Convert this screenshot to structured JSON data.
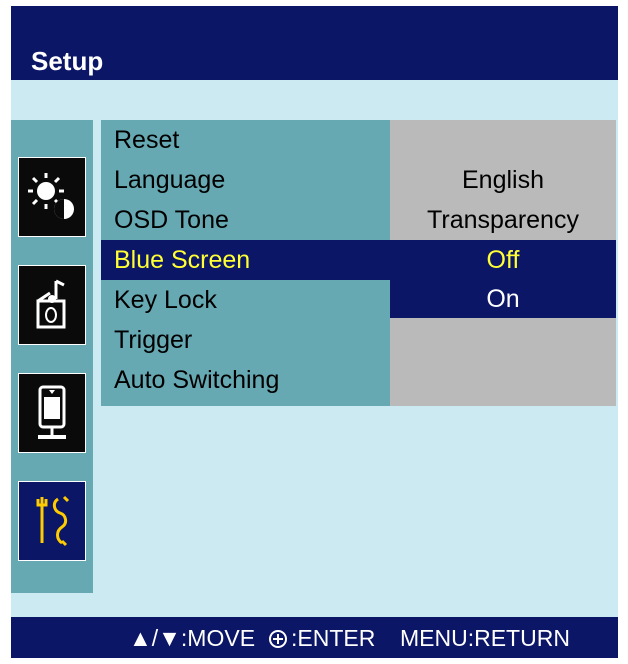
{
  "title": "Setup",
  "icons": [
    {
      "name": "brightness-contrast-icon",
      "active": false
    },
    {
      "name": "audio-icon",
      "active": false
    },
    {
      "name": "screen-adjust-icon",
      "active": false
    },
    {
      "name": "setup-tools-icon",
      "active": true
    }
  ],
  "menu": {
    "items": [
      {
        "label": "Reset"
      },
      {
        "label": "Language"
      },
      {
        "label": "OSD Tone"
      },
      {
        "label": "Blue Screen",
        "selected": true
      },
      {
        "label": "Key Lock"
      },
      {
        "label": "Trigger"
      },
      {
        "label": "Auto Switching"
      }
    ]
  },
  "values": {
    "language": "English",
    "osd_tone": "Transparency",
    "blue_screen_options": [
      "Off",
      "On"
    ],
    "blue_screen_current": "Off"
  },
  "footer": {
    "move_arrows": "▲/▼",
    "move_label": ":MOVE",
    "enter_label": ":ENTER",
    "menu_label": "MENU:RETURN"
  },
  "colors": {
    "header": "#0b1666",
    "panel": "#66a9b3",
    "background": "#cceaf2",
    "value_panel": "#bababa",
    "highlight_text": "#ffff33"
  }
}
